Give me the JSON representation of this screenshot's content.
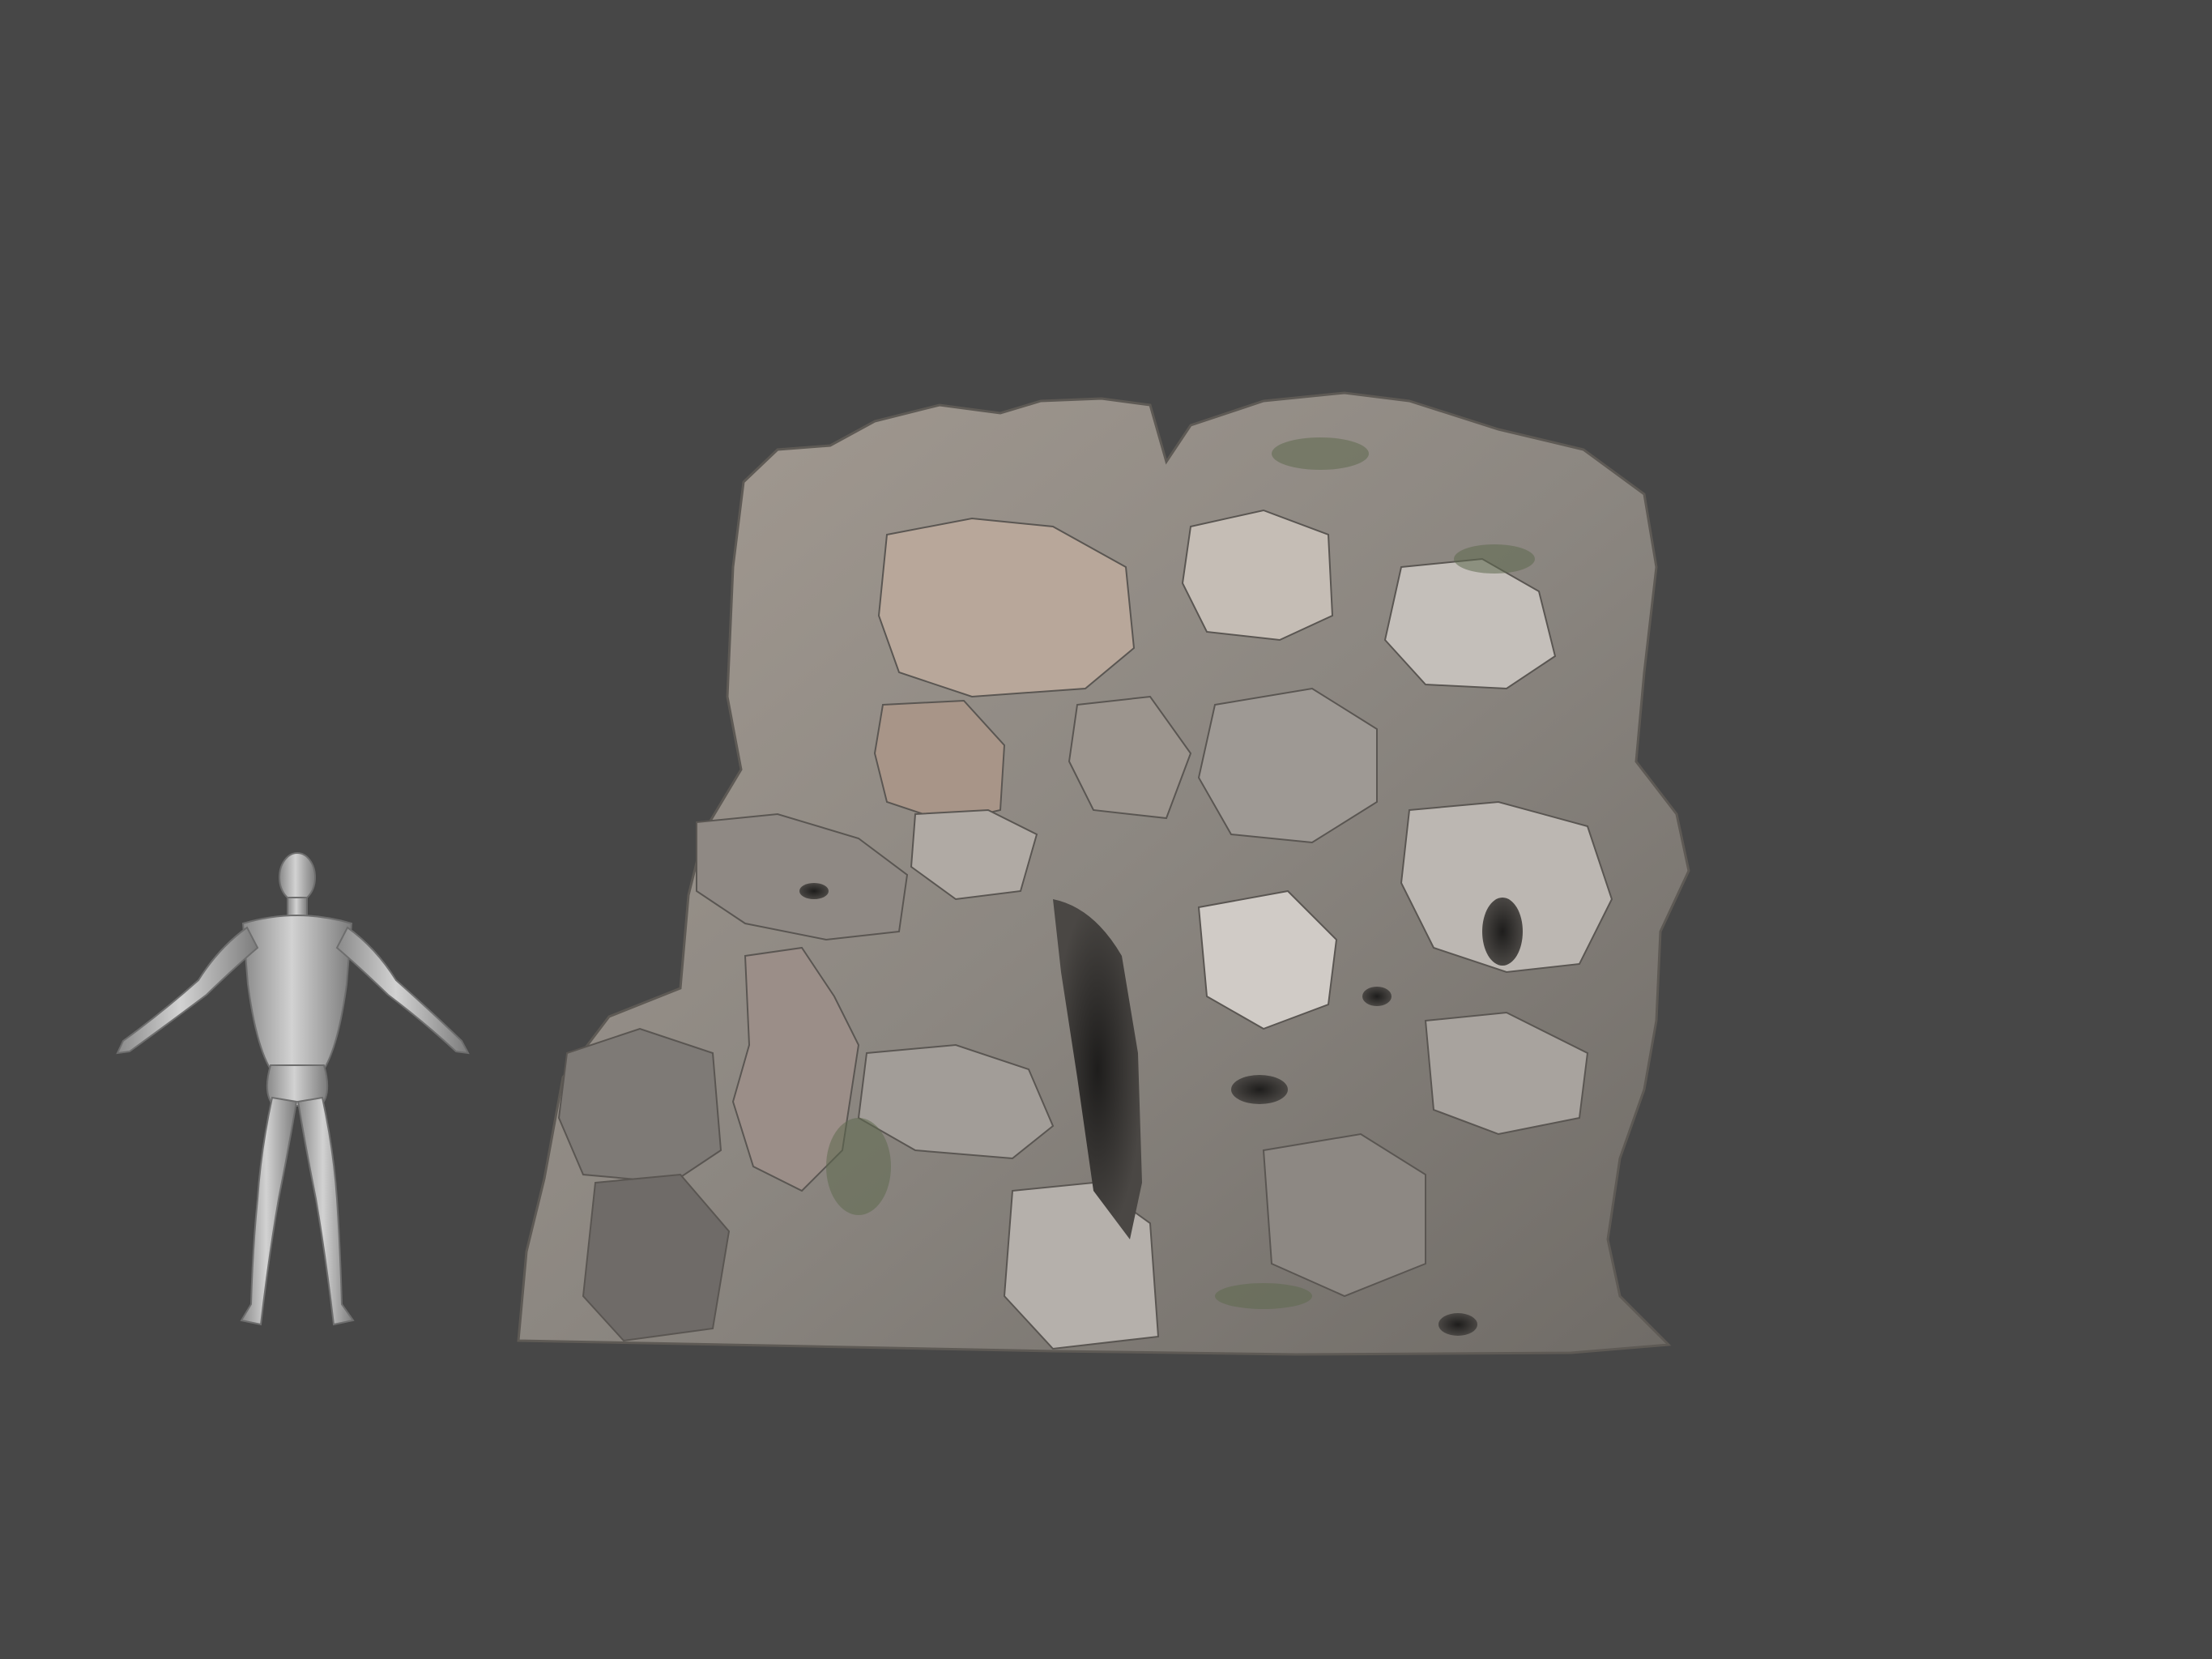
{
  "scene": {
    "background_color": "#474747",
    "objects": [
      {
        "name": "human-scale-reference",
        "color": "#b9b9b9"
      },
      {
        "name": "rock-wall-scan",
        "color": "#8f8a84"
      }
    ]
  }
}
